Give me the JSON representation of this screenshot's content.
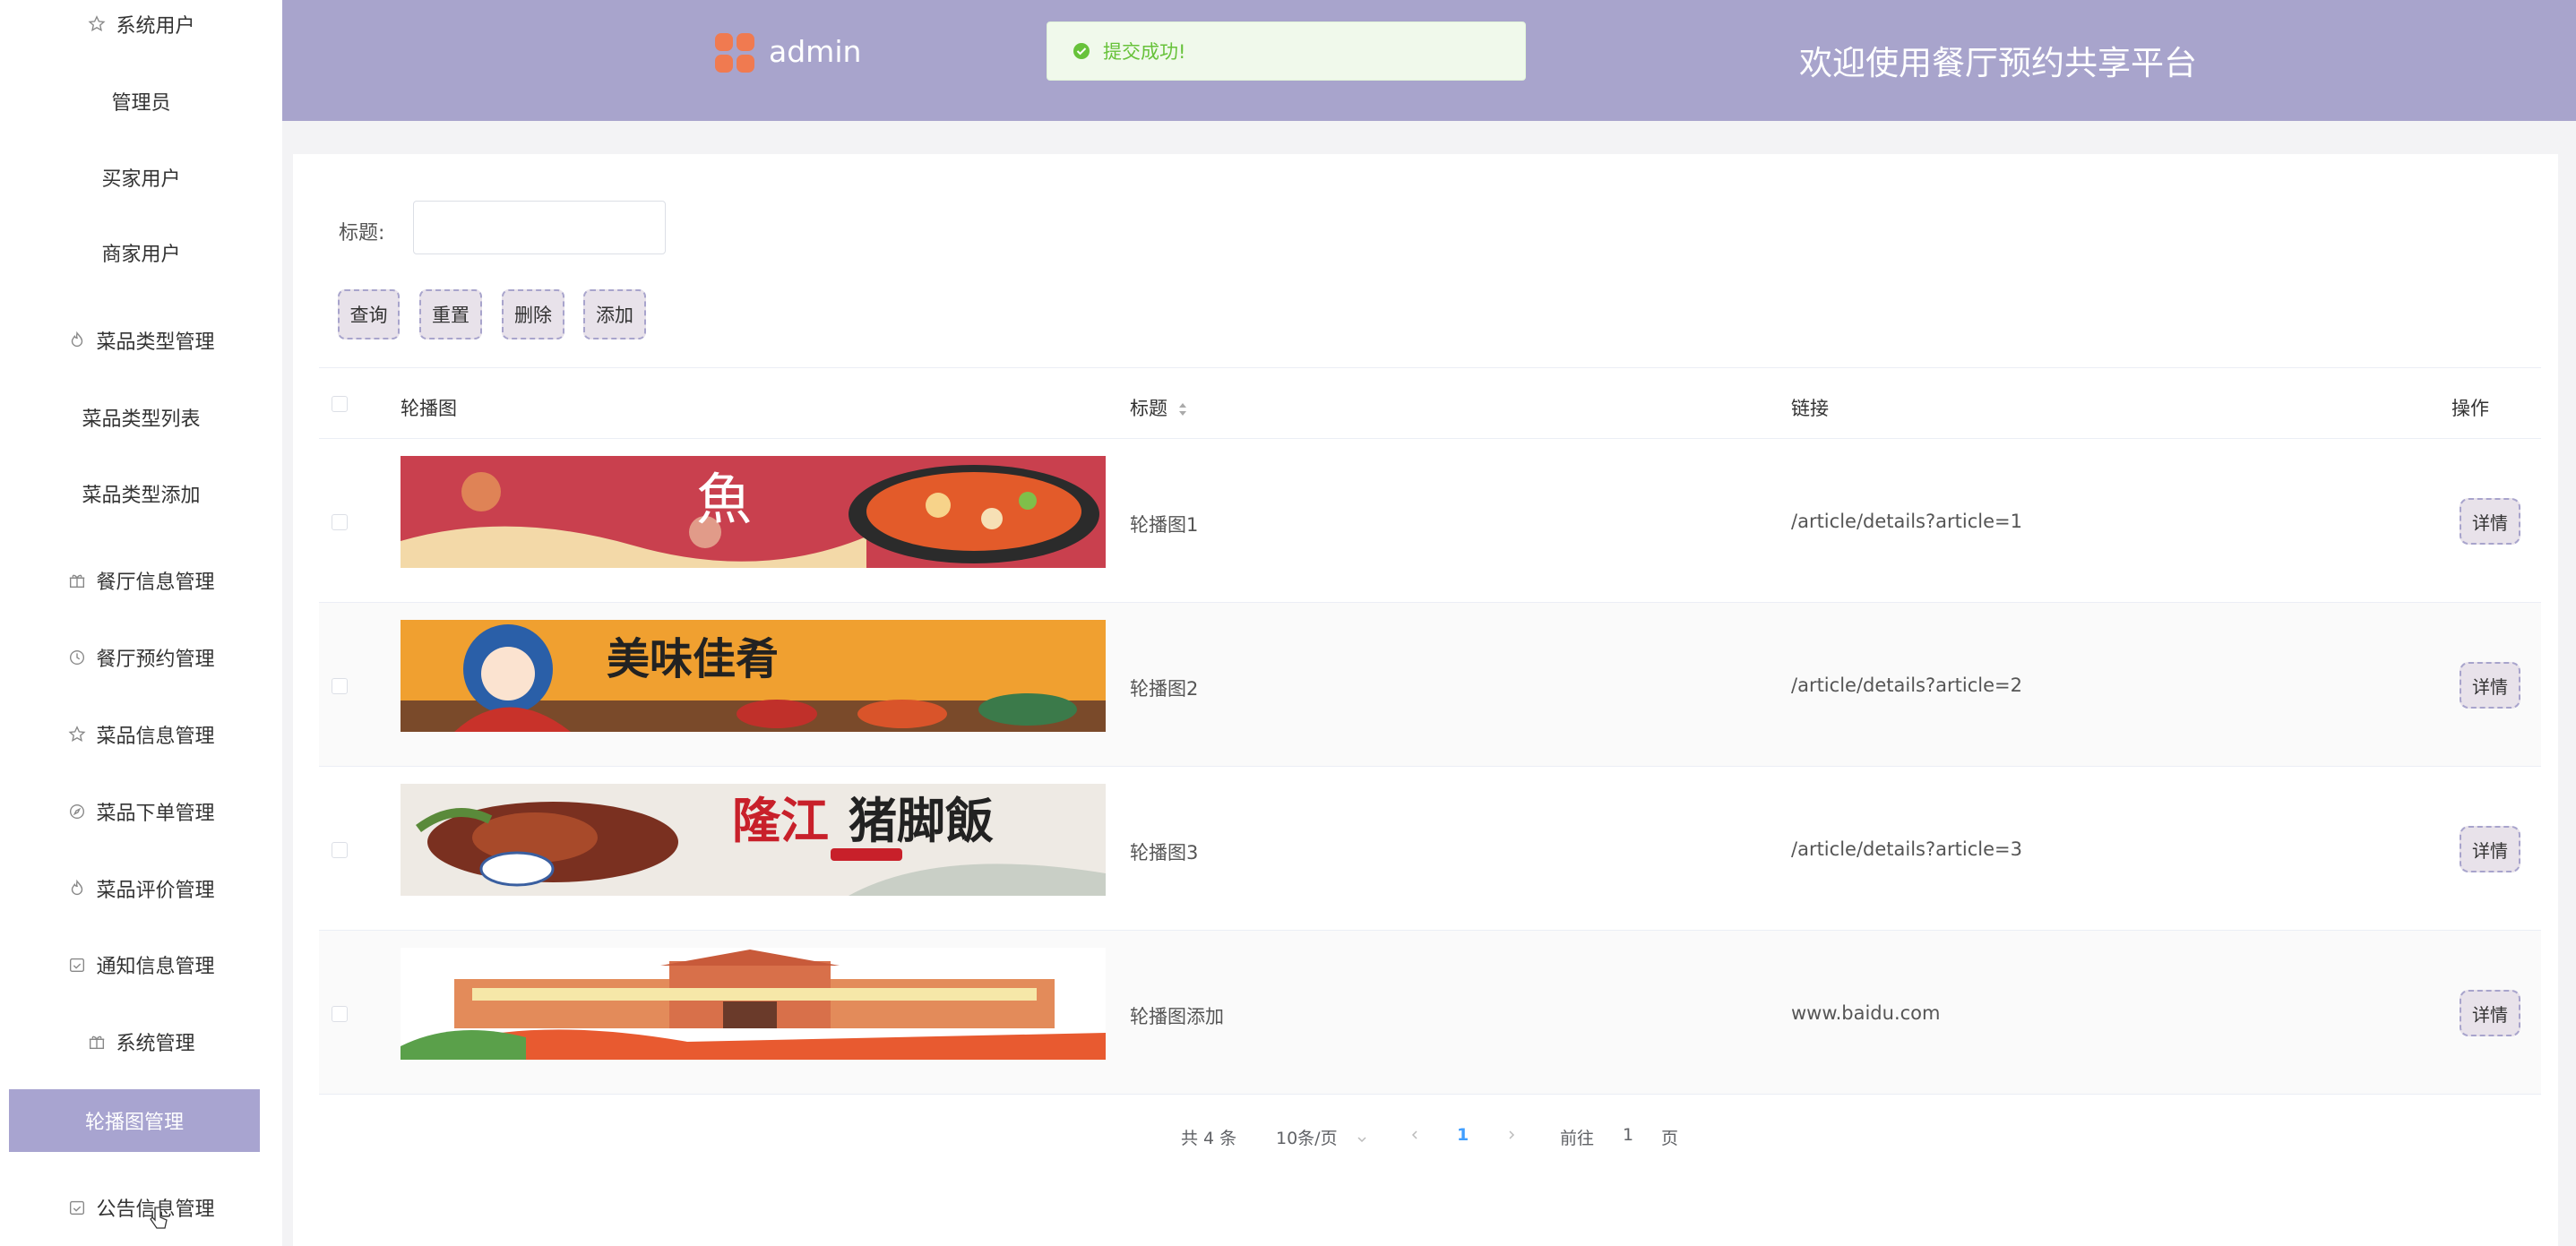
{
  "sidebar": {
    "items": [
      {
        "label": "系统用户",
        "icon": "star-icon"
      },
      {
        "label": "管理员"
      },
      {
        "label": "买家用户"
      },
      {
        "label": "商家用户"
      },
      {
        "label": "菜品类型管理",
        "icon": "flame-icon"
      },
      {
        "label": "菜品类型列表"
      },
      {
        "label": "菜品类型添加"
      },
      {
        "label": "餐厅信息管理",
        "icon": "gift-icon"
      },
      {
        "label": "餐厅预约管理",
        "icon": "clock-icon"
      },
      {
        "label": "菜品信息管理",
        "icon": "star-icon"
      },
      {
        "label": "菜品下单管理",
        "icon": "compass-icon"
      },
      {
        "label": "菜品评价管理",
        "icon": "flame-icon"
      },
      {
        "label": "通知信息管理",
        "icon": "calendar-check-icon"
      },
      {
        "label": "系统管理",
        "icon": "gift-icon"
      },
      {
        "label": "轮播图管理"
      },
      {
        "label": "公告信息管理",
        "icon": "calendar-check-icon"
      }
    ]
  },
  "header": {
    "brand": "admin",
    "welcome": "欢迎使用餐厅预约共享平台"
  },
  "toast": {
    "message": "提交成功!"
  },
  "search": {
    "label": "标题:",
    "value": ""
  },
  "buttons": {
    "query": "查询",
    "reset": "重置",
    "delete": "删除",
    "add": "添加"
  },
  "table": {
    "headers": {
      "image": "轮播图",
      "title": "标题",
      "link": "链接",
      "action": "操作"
    },
    "rows": [
      {
        "title": "轮播图1",
        "link": "/article/details?article=1",
        "action": "详情"
      },
      {
        "title": "轮播图2",
        "link": "/article/details?article=2",
        "action": "详情"
      },
      {
        "title": "轮播图3",
        "link": "/article/details?article=3",
        "action": "详情"
      },
      {
        "title": "轮播图添加",
        "link": "www.baidu.com",
        "action": "详情"
      }
    ]
  },
  "pagination": {
    "total": "共 4 条",
    "page_size": "10条/页",
    "current": "1",
    "goto_prefix": "前往",
    "goto_value": "1",
    "goto_suffix": "页"
  },
  "colors": {
    "accent": "#a8a4cc",
    "success": "#67c23a",
    "link": "#409eff"
  }
}
